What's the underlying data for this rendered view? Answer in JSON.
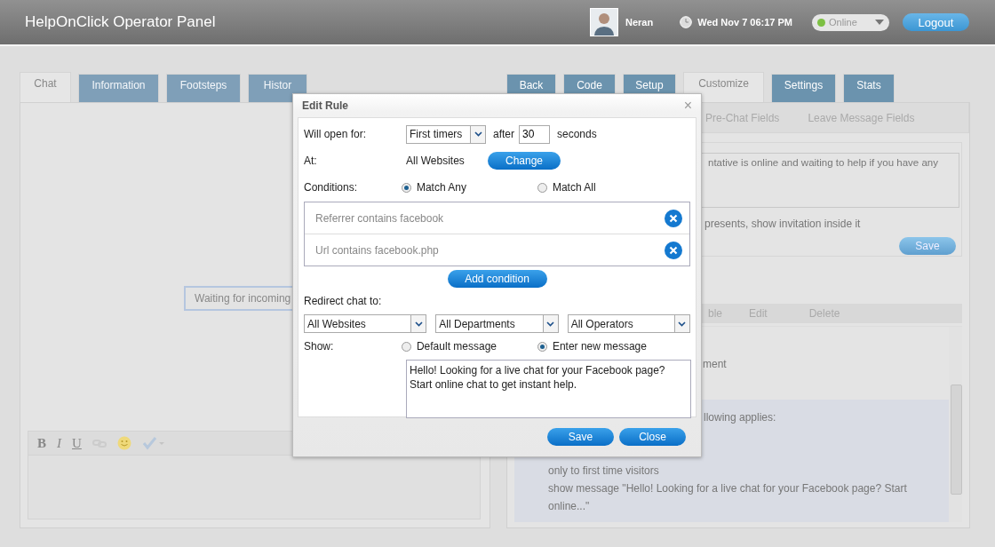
{
  "header": {
    "title": "HelpOnClick Operator Panel",
    "user": {
      "name": "Neran"
    },
    "datetime": "Wed Nov 7 06:17 PM",
    "status": {
      "label": "Online",
      "color": "#7dc043"
    },
    "logout": "Logout"
  },
  "left_panel": {
    "tabs": [
      {
        "label": "Chat",
        "selected": true
      },
      {
        "label": "Information",
        "selected": false
      },
      {
        "label": "Footsteps",
        "selected": false
      },
      {
        "label": "Histor",
        "selected": false
      }
    ],
    "waiting_text": "Waiting for incoming",
    "toolbar": [
      {
        "kind": "bold",
        "label": "B"
      },
      {
        "kind": "italic",
        "label": "I"
      },
      {
        "kind": "underline",
        "label": "U"
      },
      {
        "kind": "link"
      },
      {
        "kind": "smiley"
      },
      {
        "kind": "spellcheck"
      }
    ]
  },
  "right_panel": {
    "tabs": [
      {
        "label": "Back",
        "selected": false
      },
      {
        "label": "Code",
        "selected": false
      },
      {
        "label": "Setup",
        "selected": false
      },
      {
        "label": "Customize",
        "selected": true
      },
      {
        "label": "Settings",
        "selected": false
      },
      {
        "label": "Stats",
        "selected": false
      }
    ],
    "subtabs": [
      "Pre-Chat Fields",
      "Leave Message Fields"
    ],
    "invitation_text": "ntative is online and waiting to help if you have any",
    "position_text": "presents, show invitation inside it",
    "save_button": "Save",
    "table": {
      "columns": [
        "ble",
        "Edit",
        "Delete"
      ],
      "rows": [
        {
          "lines": [
            "ment"
          ],
          "selected": false
        },
        {
          "lines": [
            "llowing applies:",
            "only to first time visitors",
            "show message \"Hello! Looking for a live chat for your Facebook page? Start online...\""
          ],
          "selected": true
        }
      ]
    }
  },
  "dialog": {
    "title": "Edit Rule",
    "close": "×",
    "open_for": {
      "label": "Will open for:",
      "value": "First timers",
      "after": "after",
      "seconds_value": "30",
      "seconds": "seconds"
    },
    "at": {
      "label": "At:",
      "value": "All Websites",
      "button": "Change"
    },
    "conditions": {
      "label": "Conditions:",
      "options": [
        {
          "label": "Match Any",
          "selected": true
        },
        {
          "label": "Match All",
          "selected": false
        }
      ],
      "items": [
        "Referrer contains facebook",
        "Url contains facebook.php"
      ],
      "add_button": "Add condition"
    },
    "redirect": {
      "label": "Redirect chat to:",
      "selects": [
        "All Websites",
        "All Departments",
        "All Operators"
      ]
    },
    "show": {
      "label": "Show:",
      "options": [
        {
          "label": "Default message",
          "selected": false
        },
        {
          "label": "Enter new message",
          "selected": true
        }
      ],
      "message": "Hello! Looking for a live chat for your Facebook page?\nStart online chat to get instant help."
    },
    "buttons": [
      "Save",
      "Close"
    ]
  }
}
